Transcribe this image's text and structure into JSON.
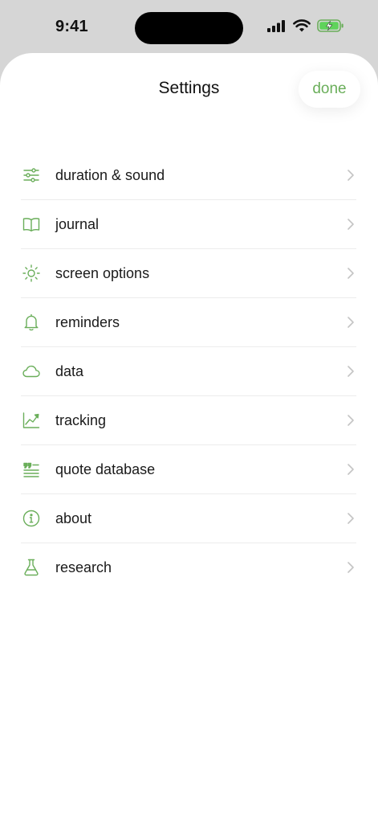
{
  "status_bar": {
    "time": "9:41"
  },
  "header": {
    "title": "Settings",
    "done_label": "done"
  },
  "colors": {
    "accent": "#6aae5a",
    "chevron": "#c4c4c4",
    "battery_fill": "#5fd35b"
  },
  "menu": {
    "items": [
      {
        "label": "duration & sound",
        "icon": "sliders-icon"
      },
      {
        "label": "journal",
        "icon": "book-icon"
      },
      {
        "label": "screen options",
        "icon": "sun-icon"
      },
      {
        "label": "reminders",
        "icon": "bell-icon"
      },
      {
        "label": "data",
        "icon": "cloud-icon"
      },
      {
        "label": "tracking",
        "icon": "trend-chart-icon"
      },
      {
        "label": "quote database",
        "icon": "quote-list-icon"
      },
      {
        "label": "about",
        "icon": "info-icon"
      },
      {
        "label": "research",
        "icon": "flask-icon"
      }
    ]
  }
}
